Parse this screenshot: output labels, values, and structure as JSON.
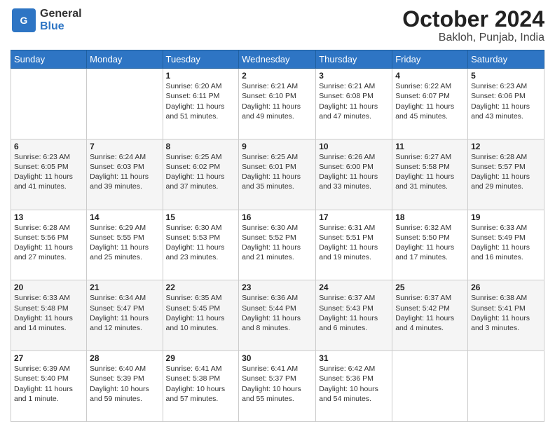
{
  "header": {
    "logo_line1": "General",
    "logo_line2": "Blue",
    "month_year": "October 2024",
    "location": "Bakloh, Punjab, India"
  },
  "weekdays": [
    "Sunday",
    "Monday",
    "Tuesday",
    "Wednesday",
    "Thursday",
    "Friday",
    "Saturday"
  ],
  "weeks": [
    [
      {
        "day": "",
        "info": ""
      },
      {
        "day": "",
        "info": ""
      },
      {
        "day": "1",
        "info": "Sunrise: 6:20 AM\nSunset: 6:11 PM\nDaylight: 11 hours and 51 minutes."
      },
      {
        "day": "2",
        "info": "Sunrise: 6:21 AM\nSunset: 6:10 PM\nDaylight: 11 hours and 49 minutes."
      },
      {
        "day": "3",
        "info": "Sunrise: 6:21 AM\nSunset: 6:08 PM\nDaylight: 11 hours and 47 minutes."
      },
      {
        "day": "4",
        "info": "Sunrise: 6:22 AM\nSunset: 6:07 PM\nDaylight: 11 hours and 45 minutes."
      },
      {
        "day": "5",
        "info": "Sunrise: 6:23 AM\nSunset: 6:06 PM\nDaylight: 11 hours and 43 minutes."
      }
    ],
    [
      {
        "day": "6",
        "info": "Sunrise: 6:23 AM\nSunset: 6:05 PM\nDaylight: 11 hours and 41 minutes."
      },
      {
        "day": "7",
        "info": "Sunrise: 6:24 AM\nSunset: 6:03 PM\nDaylight: 11 hours and 39 minutes."
      },
      {
        "day": "8",
        "info": "Sunrise: 6:25 AM\nSunset: 6:02 PM\nDaylight: 11 hours and 37 minutes."
      },
      {
        "day": "9",
        "info": "Sunrise: 6:25 AM\nSunset: 6:01 PM\nDaylight: 11 hours and 35 minutes."
      },
      {
        "day": "10",
        "info": "Sunrise: 6:26 AM\nSunset: 6:00 PM\nDaylight: 11 hours and 33 minutes."
      },
      {
        "day": "11",
        "info": "Sunrise: 6:27 AM\nSunset: 5:58 PM\nDaylight: 11 hours and 31 minutes."
      },
      {
        "day": "12",
        "info": "Sunrise: 6:28 AM\nSunset: 5:57 PM\nDaylight: 11 hours and 29 minutes."
      }
    ],
    [
      {
        "day": "13",
        "info": "Sunrise: 6:28 AM\nSunset: 5:56 PM\nDaylight: 11 hours and 27 minutes."
      },
      {
        "day": "14",
        "info": "Sunrise: 6:29 AM\nSunset: 5:55 PM\nDaylight: 11 hours and 25 minutes."
      },
      {
        "day": "15",
        "info": "Sunrise: 6:30 AM\nSunset: 5:53 PM\nDaylight: 11 hours and 23 minutes."
      },
      {
        "day": "16",
        "info": "Sunrise: 6:30 AM\nSunset: 5:52 PM\nDaylight: 11 hours and 21 minutes."
      },
      {
        "day": "17",
        "info": "Sunrise: 6:31 AM\nSunset: 5:51 PM\nDaylight: 11 hours and 19 minutes."
      },
      {
        "day": "18",
        "info": "Sunrise: 6:32 AM\nSunset: 5:50 PM\nDaylight: 11 hours and 17 minutes."
      },
      {
        "day": "19",
        "info": "Sunrise: 6:33 AM\nSunset: 5:49 PM\nDaylight: 11 hours and 16 minutes."
      }
    ],
    [
      {
        "day": "20",
        "info": "Sunrise: 6:33 AM\nSunset: 5:48 PM\nDaylight: 11 hours and 14 minutes."
      },
      {
        "day": "21",
        "info": "Sunrise: 6:34 AM\nSunset: 5:47 PM\nDaylight: 11 hours and 12 minutes."
      },
      {
        "day": "22",
        "info": "Sunrise: 6:35 AM\nSunset: 5:45 PM\nDaylight: 11 hours and 10 minutes."
      },
      {
        "day": "23",
        "info": "Sunrise: 6:36 AM\nSunset: 5:44 PM\nDaylight: 11 hours and 8 minutes."
      },
      {
        "day": "24",
        "info": "Sunrise: 6:37 AM\nSunset: 5:43 PM\nDaylight: 11 hours and 6 minutes."
      },
      {
        "day": "25",
        "info": "Sunrise: 6:37 AM\nSunset: 5:42 PM\nDaylight: 11 hours and 4 minutes."
      },
      {
        "day": "26",
        "info": "Sunrise: 6:38 AM\nSunset: 5:41 PM\nDaylight: 11 hours and 3 minutes."
      }
    ],
    [
      {
        "day": "27",
        "info": "Sunrise: 6:39 AM\nSunset: 5:40 PM\nDaylight: 11 hours and 1 minute."
      },
      {
        "day": "28",
        "info": "Sunrise: 6:40 AM\nSunset: 5:39 PM\nDaylight: 10 hours and 59 minutes."
      },
      {
        "day": "29",
        "info": "Sunrise: 6:41 AM\nSunset: 5:38 PM\nDaylight: 10 hours and 57 minutes."
      },
      {
        "day": "30",
        "info": "Sunrise: 6:41 AM\nSunset: 5:37 PM\nDaylight: 10 hours and 55 minutes."
      },
      {
        "day": "31",
        "info": "Sunrise: 6:42 AM\nSunset: 5:36 PM\nDaylight: 10 hours and 54 minutes."
      },
      {
        "day": "",
        "info": ""
      },
      {
        "day": "",
        "info": ""
      }
    ]
  ]
}
